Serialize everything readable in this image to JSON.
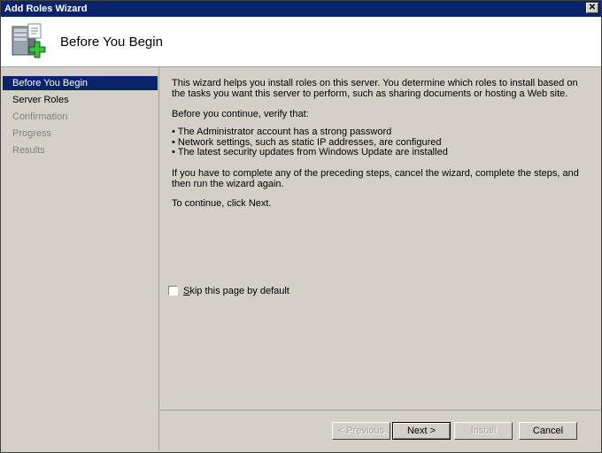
{
  "window": {
    "title": "Add Roles Wizard",
    "close_glyph": "✕"
  },
  "header": {
    "heading": "Before You Begin",
    "icon": "server-add-icon"
  },
  "sidebar": {
    "items": [
      {
        "label": "Before You Begin",
        "state": "active"
      },
      {
        "label": "Server Roles",
        "state": "normal"
      },
      {
        "label": "Confirmation",
        "state": "disabled"
      },
      {
        "label": "Progress",
        "state": "disabled"
      },
      {
        "label": "Results",
        "state": "disabled"
      }
    ]
  },
  "content": {
    "intro": "This wizard helps you install roles on this server. You determine which roles to install based on the tasks you want this server to perform, such as sharing documents or hosting a Web site.",
    "verify_intro": "Before you continue, verify that:",
    "bullets": [
      "The Administrator account has a strong password",
      "Network settings, such as static IP addresses, are configured",
      "The latest security updates from Windows Update are installed"
    ],
    "steps_text": "If you have to complete any of the preceding steps, cancel the wizard, complete the steps, and then run the wizard again.",
    "continue_text": "To continue, click Next.",
    "skip_checkbox": {
      "label": "Skip this page by default",
      "checked": false
    }
  },
  "buttons": {
    "previous": "< Previous",
    "next": "Next >",
    "install": "Install",
    "cancel": "Cancel"
  },
  "colors": {
    "titlebar": "#0a246a",
    "selection": "#0a246a",
    "face": "#d4d0c8"
  }
}
